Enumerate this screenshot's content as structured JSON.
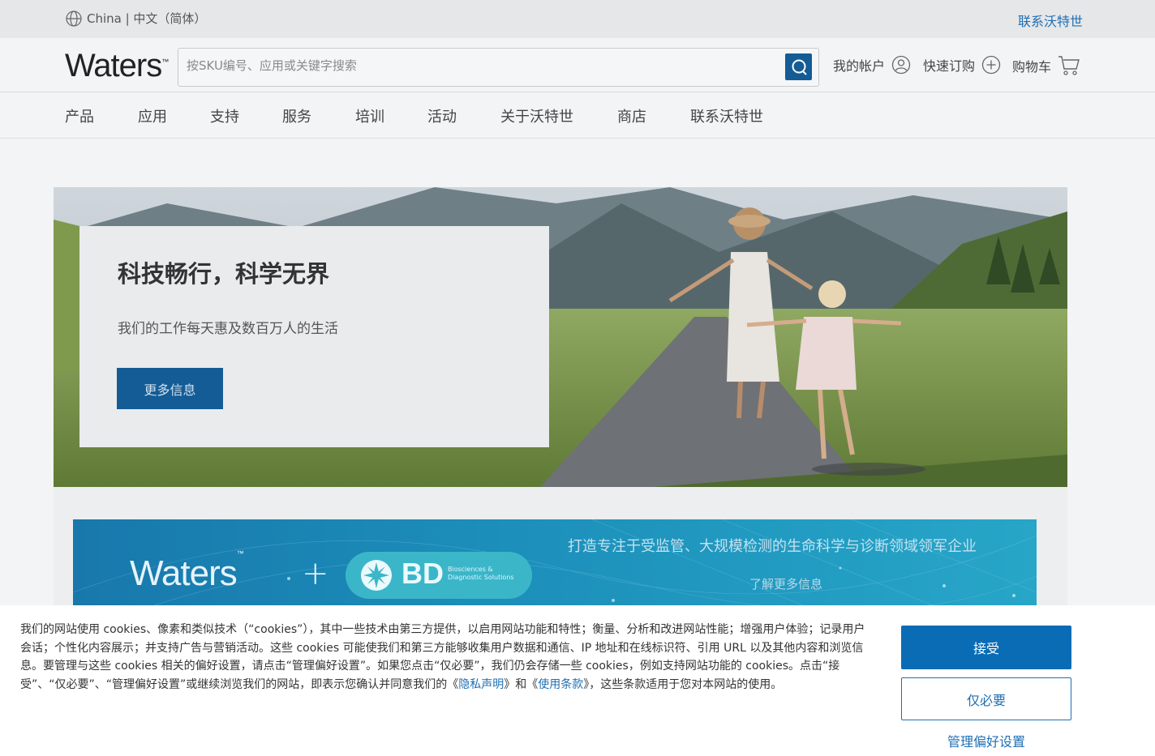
{
  "utility_bar": {
    "region": "China | 中文（简体）",
    "contact": "联系沃特世"
  },
  "header": {
    "logo": "Waters",
    "logo_tm": "™",
    "search_placeholder": "按SKU编号、应用或关键字搜索",
    "account": "我的帐户",
    "quick_order": "快速订购",
    "cart": "购物车"
  },
  "nav": {
    "items": [
      "产品",
      "应用",
      "支持",
      "服务",
      "培训",
      "活动",
      "关于沃特世",
      "商店",
      "联系沃特世"
    ]
  },
  "hero": {
    "title": "科技畅行，科学无界",
    "subtitle": "我们的工作每天惠及数百万人的生活",
    "button": "更多信息"
  },
  "promo": {
    "waters_logo": "Waters",
    "plus": "+",
    "bd_logo": "BD",
    "bd_subtitle": "Biosciences & Diagnostic Solutions",
    "title": "打造专注于受监管、大规模检测的生命科学与诊断领域领军企业",
    "link": "了解更多信息"
  },
  "cookie": {
    "text_1": "我们的网站使用 cookies、像素和类似技术（“cookies”），其中一些技术由第三方提供，以启用网站功能和特性；衡量、分析和改进网站性能；增强用户体验；记录用户会话；个性化内容展示；并支持广告与营销活动。这些 cookies 可能使我们和第三方能够收集用户数据和通信、IP 地址和在线标识符、引用 URL 以及其他内容和浏览信息。要管理与这些 cookies 相关的偏好设置，请点击“管理偏好设置”。如果您点击“仅必要”，我们仍会存储一些 cookies，例如支持网站功能的 cookies。点击“接受”、“仅必要”、“管理偏好设置”或继续浏览我们的网站，即表示您确认并同意我们的《",
    "privacy_link": "隐私声明",
    "text_2": "》和《",
    "terms_link": "使用条款",
    "text_3": "》，这些条款适用于您对本网站的使用。",
    "accept": "接受",
    "necessary": "仅必要",
    "manage": "管理偏好设置"
  },
  "colors": {
    "brand_blue": "#145c96",
    "link_blue": "#1f6fb3",
    "accept_blue": "#0a6cb5"
  }
}
